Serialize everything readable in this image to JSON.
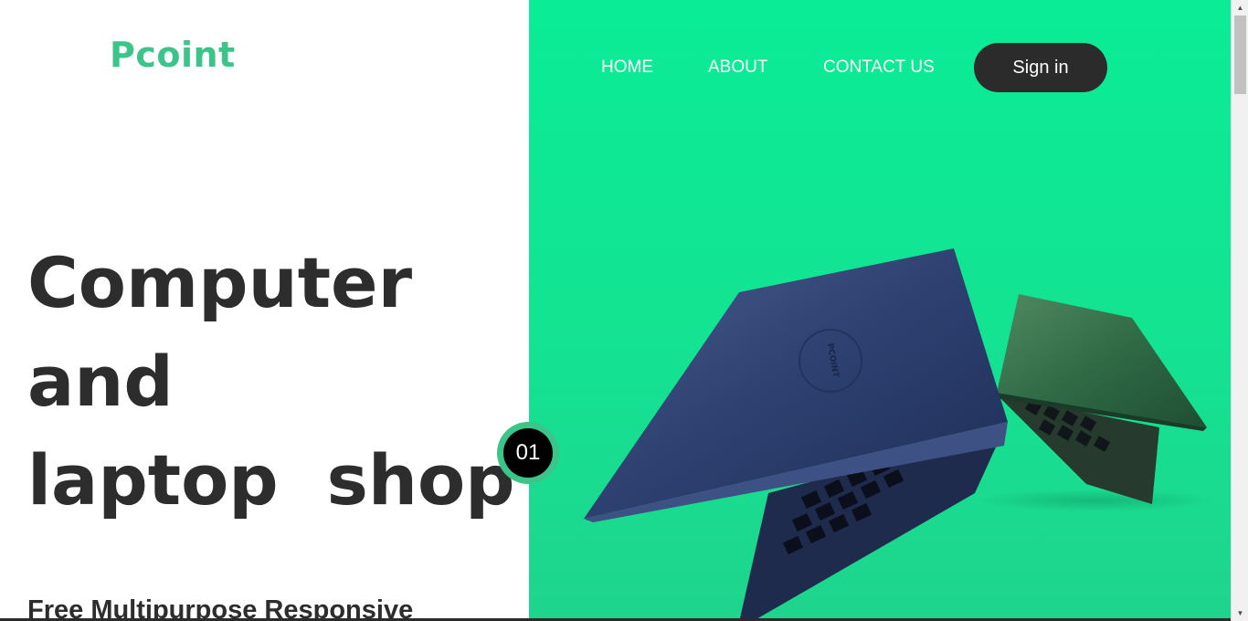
{
  "brand": {
    "logo_text": "Pcoint",
    "accent_color": "#3cc58a"
  },
  "nav": {
    "links": [
      "HOME",
      "ABOUT",
      "CONTACT US"
    ],
    "signin_label": "Sign in"
  },
  "hero": {
    "title_lines": [
      "Computer",
      "and",
      "laptop  shop"
    ],
    "subtitle": "Free Multipurpose Responsive",
    "slide_number": "01"
  },
  "product_image": {
    "logo_mark": "PCOINT",
    "panel_color": "#0aec96"
  },
  "icons": [
    "scroll-up-arrow-icon",
    "scroll-down-arrow-icon"
  ]
}
